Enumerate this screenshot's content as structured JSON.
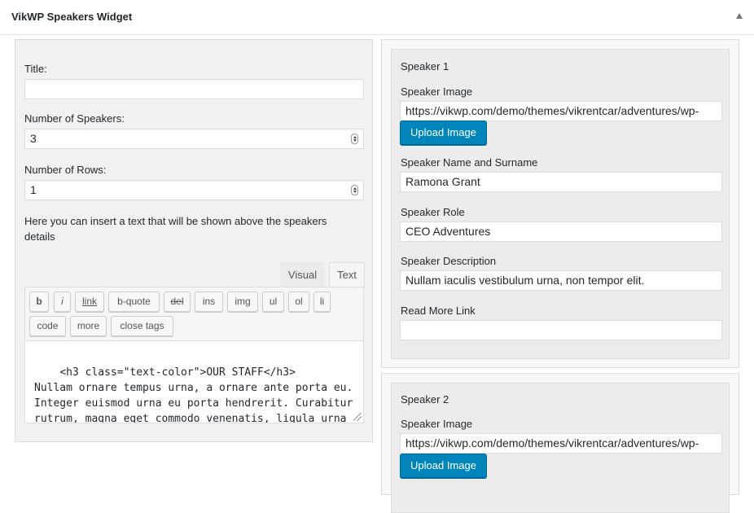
{
  "widget": {
    "title": "VikWP Speakers Widget"
  },
  "form": {
    "title_label": "Title:",
    "title_value": "",
    "num_speakers_label": "Number of Speakers:",
    "num_speakers_value": "3",
    "num_rows_label": "Number of Rows:",
    "num_rows_value": "1",
    "info_text": "Here you can insert a text that will be shown above the speakers details"
  },
  "editor": {
    "tabs": {
      "visual": "Visual",
      "text": "Text"
    },
    "buttons": [
      "b",
      "i",
      "link",
      "b-quote",
      "del",
      "ins",
      "img",
      "ul",
      "ol",
      "li",
      "code",
      "more",
      "close tags"
    ],
    "content": "<h3 class=\"text-color\">OUR STAFF</h3>\nNullam ornare tempus urna, a ornare ante porta eu.\nInteger euismod urna eu porta hendrerit. Curabitur\nrutrum, magna eget commodo venenatis, ligula urna"
  },
  "speakers": [
    {
      "heading": "Speaker 1",
      "image_label": "Speaker Image",
      "image_value": "https://vikwp.com/demo/themes/vikrentcar/adventures/wp-",
      "upload_label": "Upload Image",
      "name_label": "Speaker Name and Surname",
      "name_value": "Ramona Grant",
      "role_label": "Speaker Role",
      "role_value": "CEO Adventures",
      "desc_label": "Speaker Description",
      "desc_value": "Nullam iaculis vestibulum urna, non tempor elit.",
      "link_label": "Read More Link",
      "link_value": ""
    },
    {
      "heading": "Speaker 2",
      "image_label": "Speaker Image",
      "image_value": "https://vikwp.com/demo/themes/vikrentcar/adventures/wp-",
      "upload_label": "Upload Image"
    }
  ]
}
